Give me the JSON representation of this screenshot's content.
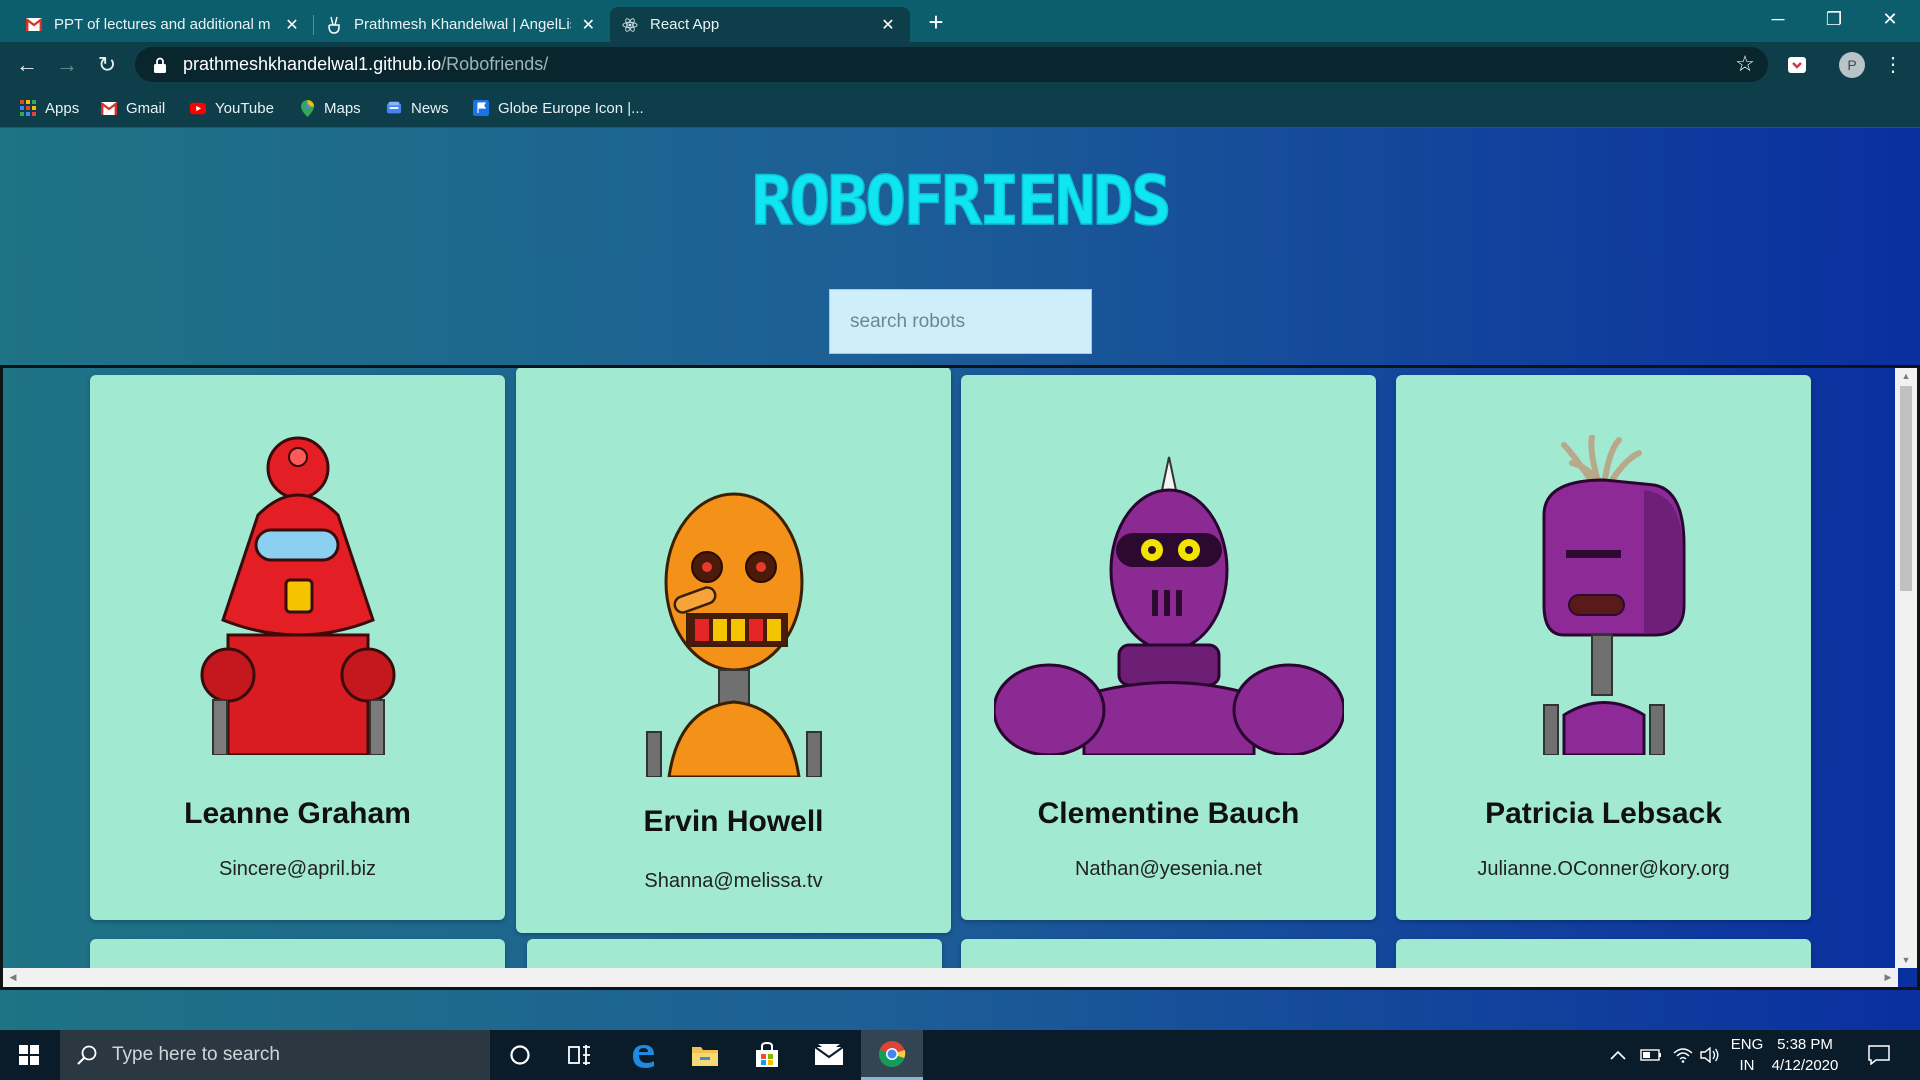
{
  "browser": {
    "tabs": [
      {
        "title": "PPT of lectures and additional m",
        "favicon": "gmail-icon",
        "active": false
      },
      {
        "title": "Prathmesh Khandelwal | AngelLis",
        "favicon": "angellist-icon",
        "active": false
      },
      {
        "title": "React App",
        "favicon": "react-icon",
        "active": true
      }
    ],
    "url_host": "prathmeshkhandelwal1.github.io",
    "url_path": "/Robofriends/",
    "profile_initial": "P"
  },
  "bookmarks": [
    {
      "label": "Apps",
      "icon": "apps-grid-icon"
    },
    {
      "label": "Gmail",
      "icon": "gmail-icon"
    },
    {
      "label": "YouTube",
      "icon": "youtube-icon"
    },
    {
      "label": "Maps",
      "icon": "maps-pin-icon"
    },
    {
      "label": "News",
      "icon": "news-icon"
    },
    {
      "label": "Globe Europe Icon |...",
      "icon": "flag-icon"
    }
  ],
  "app": {
    "title": "ROBOFRIENDS",
    "search_placeholder": "search robots",
    "robots": [
      {
        "name": "Leanne Graham",
        "email": "Sincere@april.biz",
        "color": "#e52222"
      },
      {
        "name": "Ervin Howell",
        "email": "Shanna@melissa.tv",
        "color": "#f08d1a"
      },
      {
        "name": "Clementine Bauch",
        "email": "Nathan@yesenia.net",
        "color": "#8a2a92"
      },
      {
        "name": "Patricia Lebsack",
        "email": "Julianne.OConner@kory.org",
        "color": "#8e2a98"
      }
    ]
  },
  "taskbar": {
    "search_placeholder": "Type here to search",
    "lang_1": "ENG",
    "lang_2": "IN",
    "time": "5:38 PM",
    "date": "4/12/2020"
  }
}
